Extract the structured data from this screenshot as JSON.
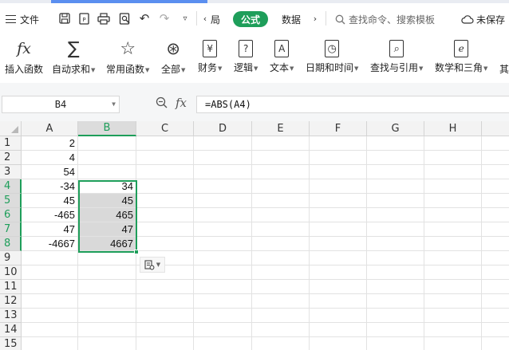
{
  "topbar": {
    "menu_label": "文件",
    "prev_tab_partial": "局",
    "tabs": [
      "公式",
      "数据"
    ],
    "active_tab": "公式",
    "search_placeholder": "查找命令、搜索模板",
    "unsaved_label": "未保存",
    "accent_color": "#1e9e5a"
  },
  "ribbon": {
    "items": [
      {
        "icon": "fx-icon",
        "glyph": "fx",
        "label": "插入函数",
        "dropdown": false
      },
      {
        "icon": "sigma-icon",
        "glyph": "∑",
        "label": "自动求和",
        "dropdown": true
      },
      {
        "icon": "star-icon",
        "glyph": "☆",
        "label": "常用函数",
        "dropdown": true
      },
      {
        "icon": "all-functions-icon",
        "glyph": "⊛",
        "label": "全部",
        "dropdown": true
      },
      {
        "icon": "finance-icon",
        "glyph": "¥",
        "label": "财务",
        "dropdown": true
      },
      {
        "icon": "logic-icon",
        "glyph": "?",
        "label": "逻辑",
        "dropdown": true
      },
      {
        "icon": "text-icon",
        "glyph": "A",
        "label": "文本",
        "dropdown": true
      },
      {
        "icon": "datetime-icon",
        "glyph": "◷",
        "label": "日期和时间",
        "dropdown": true
      },
      {
        "icon": "lookup-icon",
        "glyph": "⌕",
        "label": "查找与引用",
        "dropdown": true
      },
      {
        "icon": "math-icon",
        "glyph": "e",
        "label": "数学和三角",
        "dropdown": true
      },
      {
        "icon": "more-icon",
        "glyph": "",
        "label": "其",
        "dropdown": false
      }
    ]
  },
  "formula_bar": {
    "name_box": "B4",
    "formula": "=ABS(A4)"
  },
  "grid": {
    "columns": [
      "A",
      "B",
      "C",
      "D",
      "E",
      "F",
      "G",
      "H"
    ],
    "selected_column": "B",
    "rows": [
      {
        "n": "1",
        "a": "2",
        "b": ""
      },
      {
        "n": "2",
        "a": "4",
        "b": ""
      },
      {
        "n": "3",
        "a": "54",
        "b": ""
      },
      {
        "n": "4",
        "a": "-34",
        "b": "34"
      },
      {
        "n": "5",
        "a": "45",
        "b": "45"
      },
      {
        "n": "6",
        "a": "-465",
        "b": "465"
      },
      {
        "n": "7",
        "a": "47",
        "b": "47"
      },
      {
        "n": "8",
        "a": "-4667",
        "b": "4667"
      },
      {
        "n": "9",
        "a": "",
        "b": ""
      },
      {
        "n": "10",
        "a": "",
        "b": ""
      },
      {
        "n": "11",
        "a": "",
        "b": ""
      },
      {
        "n": "12",
        "a": "",
        "b": ""
      },
      {
        "n": "13",
        "a": "",
        "b": ""
      },
      {
        "n": "14",
        "a": "",
        "b": ""
      },
      {
        "n": "15",
        "a": "",
        "b": ""
      }
    ],
    "selected_rows": [
      "4",
      "5",
      "6",
      "7",
      "8"
    ]
  }
}
